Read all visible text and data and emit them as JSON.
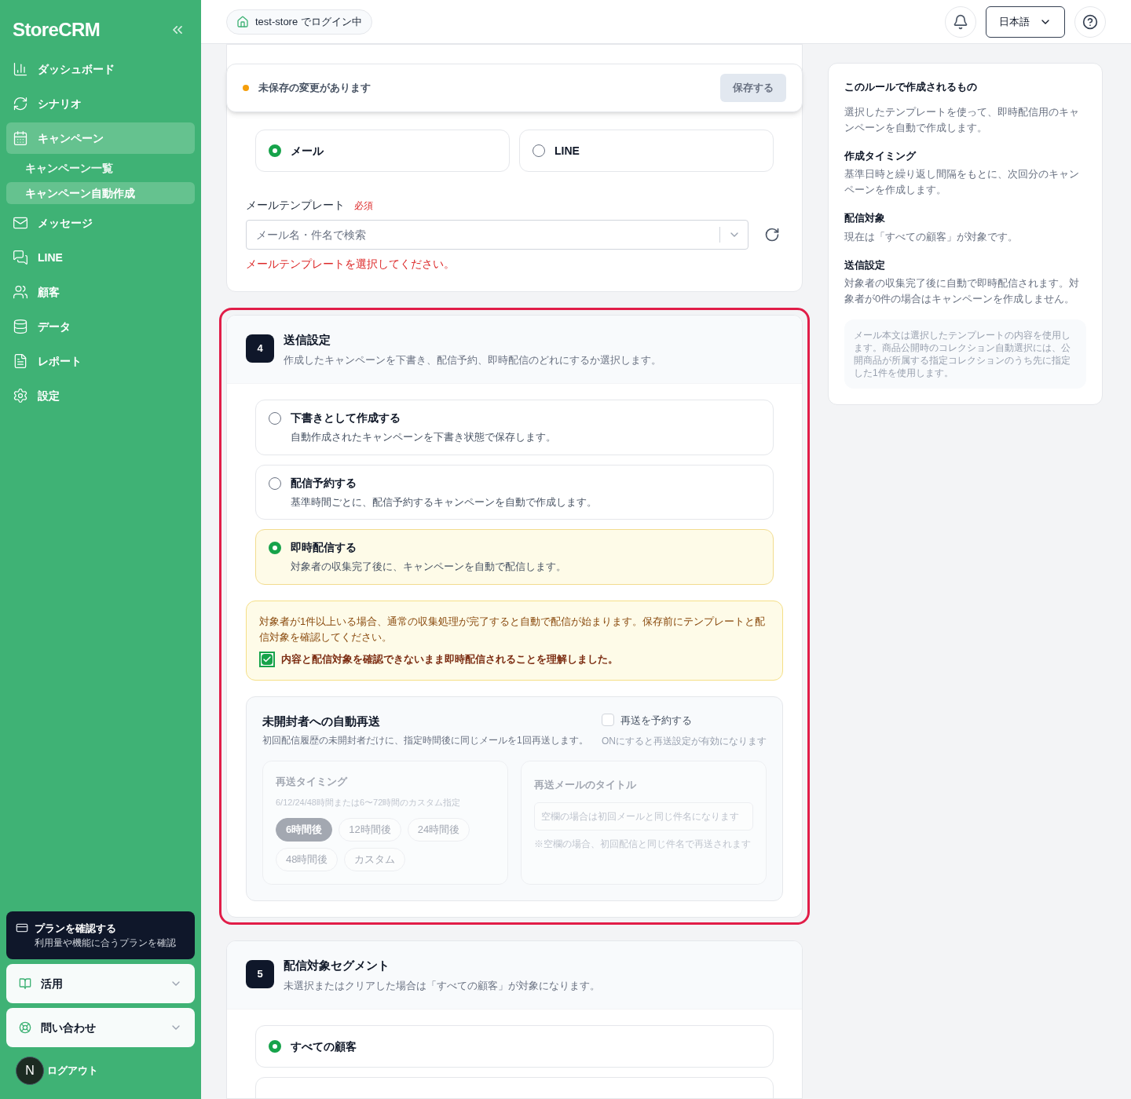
{
  "sidebar": {
    "logo": "StoreCRM",
    "items": [
      {
        "label": "ダッシュボード",
        "selected": false
      },
      {
        "label": "シナリオ",
        "selected": false
      },
      {
        "label": "キャンペーン",
        "selected": true,
        "children": [
          {
            "label": "キャンペーン一覧",
            "selected": false
          },
          {
            "label": "キャンペーン自動作成",
            "selected": true
          }
        ]
      },
      {
        "label": "メッセージ",
        "selected": false
      },
      {
        "label": "LINE",
        "selected": false
      },
      {
        "label": "顧客",
        "selected": false
      },
      {
        "label": "データ",
        "selected": false
      },
      {
        "label": "レポート",
        "selected": false
      },
      {
        "label": "設定",
        "selected": false
      }
    ],
    "plan": {
      "title": "プランを確認する",
      "subtitle": "利用量や機能に合うプランを確認"
    },
    "menus": [
      {
        "label": "活用",
        "expanded": false
      },
      {
        "label": "問い合わせ",
        "expanded": false
      }
    ],
    "avatar": "N",
    "logout": "ログアウト"
  },
  "topbar": {
    "login_status": "test-store でログイン中",
    "language": "日本語"
  },
  "unsaved_banner": {
    "message": "未保存の変更があります",
    "save_button": "保存する",
    "disabled": true
  },
  "channel_section": {
    "channels": [
      {
        "label": "メール",
        "selected": true
      },
      {
        "label": "LINE",
        "selected": false
      }
    ],
    "template_label": "メールテンプレート",
    "required": "必須",
    "template_placeholder": "メール名・件名で検索",
    "error": "メールテンプレートを選択してください。"
  },
  "send_section": {
    "step": "4",
    "title": "送信設定",
    "description": "作成したキャンペーンを下書き、配信予約、即時配信のどれにするか選択します。",
    "highlighted": true,
    "options": [
      {
        "title": "下書きとして作成する",
        "description": "自動作成されたキャンペーンを下書き状態で保存します。",
        "selected": false
      },
      {
        "title": "配信予約する",
        "description": "基準時間ごとに、配信予約するキャンペーンを自動で作成します。",
        "selected": false
      },
      {
        "title": "即時配信する",
        "description": "対象者の収集完了後に、キャンペーンを自動で配信します。",
        "selected": true
      }
    ],
    "warning": {
      "text": "対象者が1件以上いる場合、通常の収集処理が完了すると自動で配信が始まります。保存前にテンプレートと配信対象を確認してください。",
      "confirm_label": "内容と配信対象を確認できないまま即時配信されることを理解しました。",
      "checked": true
    },
    "resend": {
      "title": "未開封者への自動再送",
      "description": "初回配信履歴の未開封者だけに、指定時間後に同じメールを1回再送します。",
      "toggle_label": "再送を予約する",
      "checked": false,
      "toggle_hint": "ONにすると再送設定が有効になります",
      "disabled": true,
      "timing_label": "再送タイミング",
      "timing_hint": "6/12/24/48時間または6〜72時間のカスタム指定",
      "timings": [
        {
          "label": "6時間後",
          "selected": true
        },
        {
          "label": "12時間後",
          "selected": false
        },
        {
          "label": "24時間後",
          "selected": false
        },
        {
          "label": "48時間後",
          "selected": false
        },
        {
          "label": "カスタム",
          "selected": false
        }
      ],
      "title_label": "再送メールのタイトル",
      "title_placeholder": "空欄の場合は初回メールと同じ件名になります",
      "title_hint": "※空欄の場合、初回配信と同じ件名で再送されます"
    }
  },
  "segment_section": {
    "step": "5",
    "title": "配信対象セグメント",
    "description": "未選択またはクリアした場合は「すべての顧客」が対象になります。",
    "options": [
      {
        "label": "すべての顧客",
        "selected": true
      }
    ]
  },
  "summary": {
    "title": "このルールで作成されるもの",
    "intro": "選択したテンプレートを使って、即時配信用のキャンペーンを自動で作成します。",
    "items": [
      {
        "heading": "作成タイミング",
        "text": "基準日時と繰り返し間隔をもとに、次回分のキャンペーンを作成します。"
      },
      {
        "heading": "配信対象",
        "text": "現在は「すべての顧客」が対象です。"
      },
      {
        "heading": "送信設定",
        "text": "対象者の収集完了後に自動で即時配信されます。対象者が0件の場合はキャンペーンを作成しません。"
      }
    ],
    "note": "メール本文は選択したテンプレートの内容を使用します。商品公開時のコレクション自動選択には、公開商品が所属する指定コレクションのうち先に指定した1件を使用します。"
  }
}
